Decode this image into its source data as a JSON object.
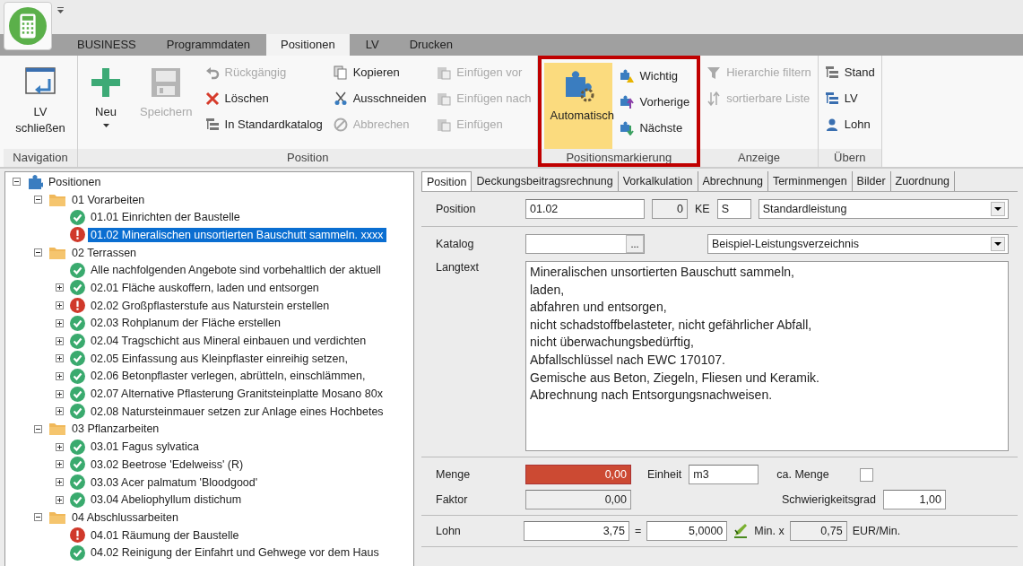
{
  "ribbon": {
    "tabs": [
      {
        "label": "BUSINESS",
        "selected": false
      },
      {
        "label": "Programmdaten",
        "selected": false
      },
      {
        "label": "Positionen",
        "selected": true
      },
      {
        "label": "LV",
        "selected": false
      },
      {
        "label": "Drucken",
        "selected": false
      }
    ],
    "groups": [
      {
        "label": "Navigation",
        "highlighted": false,
        "columns": [
          {
            "kind": "large",
            "items": [
              {
                "label": "LV schließen",
                "disabled": false,
                "selected": false
              }
            ]
          }
        ]
      },
      {
        "label": "Position",
        "highlighted": false,
        "columns": [
          {
            "kind": "large",
            "items": [
              {
                "label": "Neu",
                "disabled": false,
                "selected": false,
                "dropdown": true
              }
            ]
          },
          {
            "kind": "large",
            "items": [
              {
                "label": "Speichern",
                "disabled": true,
                "selected": false
              }
            ]
          },
          {
            "kind": "stack",
            "items": [
              {
                "label": "Rückgängig",
                "disabled": true,
                "selected": false
              },
              {
                "label": "Löschen",
                "disabled": false,
                "selected": false
              },
              {
                "label": "In Standardkatalog",
                "disabled": false,
                "selected": false
              }
            ]
          },
          {
            "kind": "stack",
            "items": [
              {
                "label": "Kopieren",
                "disabled": false,
                "selected": false
              },
              {
                "label": "Ausschneiden",
                "disabled": false,
                "selected": false
              },
              {
                "label": "Abbrechen",
                "disabled": true,
                "selected": false
              }
            ]
          },
          {
            "kind": "stack",
            "items": [
              {
                "label": "Einfügen vor",
                "disabled": true,
                "selected": false
              },
              {
                "label": "Einfügen nach",
                "disabled": true,
                "selected": false
              },
              {
                "label": "Einfügen",
                "disabled": true,
                "selected": false
              }
            ]
          }
        ]
      },
      {
        "label": "Positionsmarkierung",
        "highlighted": true,
        "columns": [
          {
            "kind": "large",
            "items": [
              {
                "label": "Automatisch",
                "disabled": false,
                "selected": true
              }
            ]
          },
          {
            "kind": "stack",
            "items": [
              {
                "label": "Wichtig",
                "disabled": false,
                "selected": false
              },
              {
                "label": "Vorherige",
                "disabled": false,
                "selected": false
              },
              {
                "label": "Nächste",
                "disabled": false,
                "selected": false
              }
            ]
          }
        ]
      },
      {
        "label": "Anzeige",
        "highlighted": false,
        "columns": [
          {
            "kind": "stack",
            "items": [
              {
                "label": "Hierarchie filtern",
                "disabled": true,
                "selected": false
              },
              {
                "label": "sortierbare Liste",
                "disabled": true,
                "selected": false
              }
            ]
          }
        ]
      },
      {
        "label": "Übern",
        "highlighted": false,
        "columns": [
          {
            "kind": "stack",
            "items": [
              {
                "label": "Stand",
                "disabled": false,
                "selected": false
              },
              {
                "label": "LV",
                "disabled": false,
                "selected": false
              },
              {
                "label": "Lohn",
                "disabled": false,
                "selected": false
              }
            ]
          }
        ]
      }
    ]
  },
  "tree": {
    "label": "Positionen",
    "kind": "root",
    "expanded": true,
    "selected": false,
    "children": [
      {
        "label": "01 Vorarbeiten",
        "kind": "folder",
        "expanded": true,
        "selected": false,
        "children": [
          {
            "label": "01.01 Einrichten der Baustelle",
            "kind": "ok",
            "selected": false
          },
          {
            "label": "01.02 Mineralischen unsortierten Bauschutt sammeln. xxxx",
            "kind": "warning",
            "selected": true
          }
        ]
      },
      {
        "label": "02 Terrassen",
        "kind": "folder",
        "expanded": true,
        "selected": false,
        "children": [
          {
            "label": "Alle nachfolgenden Angebote sind vorbehaltlich der aktuell",
            "kind": "ok",
            "selected": false
          },
          {
            "label": "02.01 Fläche auskoffern, laden und entsorgen",
            "kind": "ok",
            "expanded": false,
            "selected": false
          },
          {
            "label": "02.02 Großpflasterstufe aus Naturstein erstellen",
            "kind": "warning",
            "expanded": false,
            "selected": false
          },
          {
            "label": "02.03 Rohplanum der Fläche erstellen",
            "kind": "ok",
            "expanded": false,
            "selected": false
          },
          {
            "label": "02.04 Tragschicht aus Mineral einbauen und verdichten",
            "kind": "ok",
            "expanded": false,
            "selected": false
          },
          {
            "label": "02.05 Einfassung aus Kleinpflaster einreihig setzen,",
            "kind": "ok",
            "expanded": false,
            "selected": false
          },
          {
            "label": "02.06 Betonpflaster verlegen, abrütteln, einschlämmen,",
            "kind": "ok",
            "expanded": false,
            "selected": false
          },
          {
            "label": "02.07 Alternative Pflasterung Granitsteinplatte Mosano 80x",
            "kind": "ok",
            "expanded": false,
            "selected": false
          },
          {
            "label": "02.08 Natursteinmauer setzen zur Anlage eines Hochbetes",
            "kind": "ok",
            "expanded": false,
            "selected": false
          }
        ]
      },
      {
        "label": "03 Pflanzarbeiten",
        "kind": "folder",
        "expanded": true,
        "selected": false,
        "children": [
          {
            "label": "03.01 Fagus sylvatica",
            "kind": "ok",
            "expanded": false,
            "selected": false
          },
          {
            "label": "03.02 Beetrose 'Edelweiss' (R)",
            "kind": "ok",
            "expanded": false,
            "selected": false
          },
          {
            "label": "03.03 Acer palmatum 'Bloodgood'",
            "kind": "ok",
            "expanded": false,
            "selected": false
          },
          {
            "label": "03.04 Abeliophyllum distichum",
            "kind": "ok",
            "expanded": false,
            "selected": false
          }
        ]
      },
      {
        "label": "04 Abschlussarbeiten",
        "kind": "folder",
        "expanded": true,
        "selected": false,
        "children": [
          {
            "label": "04.01 Räumung der Baustelle",
            "kind": "warning",
            "selected": false
          },
          {
            "label": "04.02 Reinigung der Einfahrt und Gehwege vor dem Haus",
            "kind": "ok",
            "selected": false
          }
        ]
      }
    ]
  },
  "detail": {
    "tabs": [
      {
        "label": "Position",
        "selected": true
      },
      {
        "label": "Deckungsbeitragsrechnung",
        "selected": false
      },
      {
        "label": "Vorkalkulation",
        "selected": false
      },
      {
        "label": "Abrechnung",
        "selected": false
      },
      {
        "label": "Terminmengen",
        "selected": false
      },
      {
        "label": "Bilder",
        "selected": false
      },
      {
        "label": "Zuordnung",
        "selected": false
      }
    ],
    "position": {
      "label": "Position",
      "value": "01.02",
      "ke_value": "0",
      "ke_label": "KE",
      "type_code": "S",
      "type": "Standardleistung"
    },
    "katalog": {
      "label": "Katalog",
      "browse": "...",
      "catalog": "Beispiel-Leistungsverzeichnis"
    },
    "langtext": {
      "label": "Langtext",
      "value": "Mineralischen unsortierten Bauschutt sammeln,\nladen,\nabfahren und entsorgen,\nnicht schadstoffbelasteter, nicht gefährlicher Abfall,\nnicht überwachungsbedürftig,\nAbfallschlüssel nach EWC 170107.\nGemische aus Beton, Ziegeln, Fliesen und Keramik.\nAbrechnung nach Entsorgungsnachweisen."
    },
    "menge": {
      "label": "Menge",
      "value": "0,00",
      "invalid": true,
      "unit_label": "Einheit",
      "unit": "m3",
      "approx_label": "ca. Menge",
      "approx_checked": false
    },
    "faktor": {
      "label": "Faktor",
      "value": "0,00",
      "difficulty_label": "Schwierigkeitsgrad",
      "difficulty": "1,00"
    },
    "lohn": {
      "label": "Lohn",
      "value": "3,75",
      "equals": "=",
      "minutes": "5,0000",
      "min_label": "Min. x",
      "rate": "0,75",
      "rate_unit": "EUR/Min."
    }
  }
}
